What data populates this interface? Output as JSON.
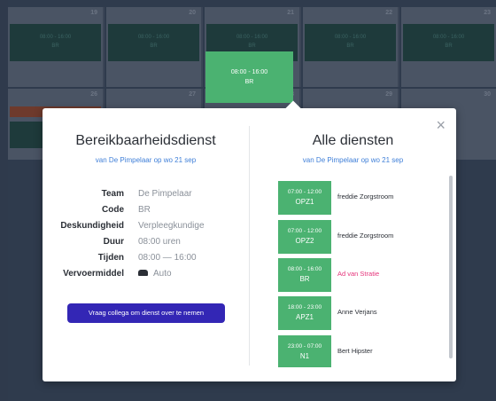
{
  "calendar": {
    "week1": [
      {
        "day": "19",
        "shift": "08:00 - 16:00",
        "code": "BR"
      },
      {
        "day": "20",
        "shift": "08:00 - 16:00",
        "code": "BR"
      },
      {
        "day": "21",
        "shift": "08:00 - 16:00",
        "code": "BR"
      },
      {
        "day": "22",
        "shift": "08:00 - 16:00",
        "code": "BR"
      },
      {
        "day": "23",
        "shift": "08:00 - 16:00",
        "code": "BR"
      }
    ],
    "week2": [
      {
        "day": "26"
      },
      {
        "day": "27"
      },
      {
        "day": "28"
      },
      {
        "day": "29"
      },
      {
        "day": "30"
      }
    ],
    "active_tile": {
      "time": "08:00 - 16:00",
      "code": "BR"
    }
  },
  "modal": {
    "close_icon": "×",
    "left": {
      "title": "Bereikbaarheidsdienst",
      "subtitle": "van De Pimpelaar op wo 21 sep",
      "details": [
        {
          "label": "Team",
          "value": "De Pimpelaar"
        },
        {
          "label": "Code",
          "value": "BR"
        },
        {
          "label": "Deskundigheid",
          "value": "Verpleegkundige"
        },
        {
          "label": "Duur",
          "value": "08:00 uren"
        },
        {
          "label": "Tijden",
          "value": "08:00  —  16:00"
        },
        {
          "label": "Vervoermiddel",
          "value": "Auto",
          "icon": "car-icon"
        }
      ],
      "take_over_button": "Vraag collega om dienst over te nemen"
    },
    "right": {
      "title": "Alle diensten",
      "subtitle": "van De Pimpelaar op wo 21 sep",
      "shifts": [
        {
          "time": "07:00  -  12:00",
          "code": "OPZ1",
          "name": "freddie Zorgstroom",
          "highlight": false
        },
        {
          "time": "07:00  -  12:00",
          "code": "OPZ2",
          "name": "freddie Zorgstroom",
          "highlight": false
        },
        {
          "time": "08:00  -  16:00",
          "code": "BR",
          "name": "Ad van Stratie",
          "highlight": true
        },
        {
          "time": "18:00  -  23:00",
          "code": "APZ1",
          "name": "Anne Verjans",
          "highlight": false
        },
        {
          "time": "23:00  -  07:00",
          "code": "N1",
          "name": "Bert Hipster",
          "highlight": false
        }
      ]
    }
  },
  "colors": {
    "shift_green": "#4bb271",
    "button_blue": "#3326b5",
    "link_blue": "#3f7fd8",
    "highlight_pink": "#e5337a"
  }
}
